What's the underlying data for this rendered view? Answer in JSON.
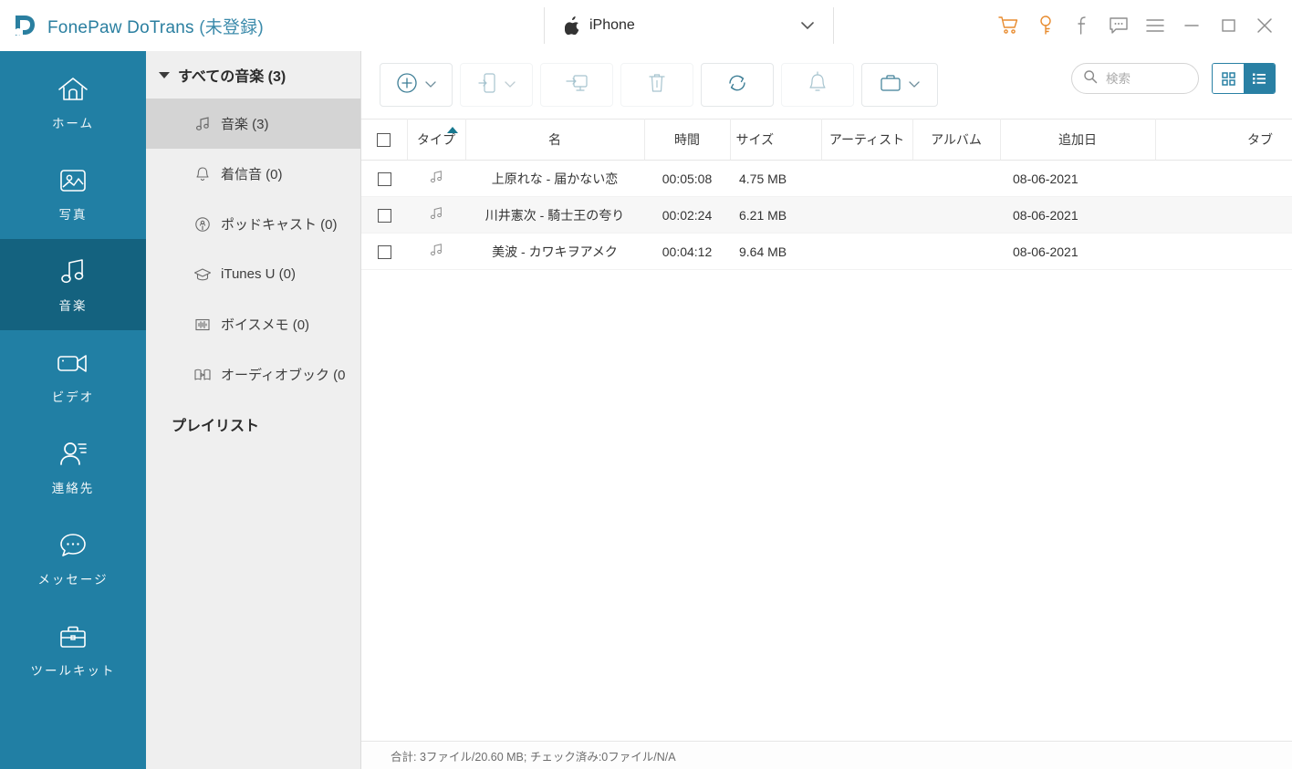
{
  "app": {
    "title": "FonePaw DoTrans",
    "title_suffix": "(未登録)",
    "accent": "#2980a4",
    "accent_dark": "#14627f",
    "orange": "#e88b2e"
  },
  "titlebar": {
    "device": {
      "name": "iPhone",
      "icon": "apple-icon",
      "chevron": "chevron-down-icon"
    },
    "icons": [
      {
        "name": "cart-icon",
        "glyph": "cart",
        "color": "#e88b2e"
      },
      {
        "name": "key-icon",
        "glyph": "key",
        "color": "#e88b2e"
      },
      {
        "name": "facebook-icon",
        "glyph": "f",
        "color": "#8d8d8d"
      },
      {
        "name": "feedback-chat-icon",
        "glyph": "chat",
        "color": "#8d8d8d"
      },
      {
        "name": "menu-icon",
        "glyph": "hamburger",
        "color": "#8d8d8d"
      },
      {
        "name": "minimize-icon",
        "glyph": "minimize",
        "color": "#8d8d8d"
      },
      {
        "name": "maximize-icon",
        "glyph": "maximize",
        "color": "#8d8d8d"
      },
      {
        "name": "close-icon",
        "glyph": "close",
        "color": "#8d8d8d"
      }
    ]
  },
  "sidebar": {
    "items": [
      {
        "label": "ホーム",
        "icon": "home-icon",
        "active": false
      },
      {
        "label": "写真",
        "icon": "photo-icon",
        "active": false
      },
      {
        "label": "音楽",
        "icon": "music-icon",
        "active": true
      },
      {
        "label": "ビデオ",
        "icon": "video-icon",
        "active": false
      },
      {
        "label": "連絡先",
        "icon": "contacts-icon",
        "active": false
      },
      {
        "label": "メッセージ",
        "icon": "message-icon",
        "active": false
      },
      {
        "label": "ツールキット",
        "icon": "toolkit-icon",
        "active": false
      }
    ]
  },
  "tree": {
    "header": "すべての音楽 (3)",
    "items": [
      {
        "label": "音楽 (3)",
        "icon": "music-note-icon",
        "selected": true
      },
      {
        "label": "着信音 (0)",
        "icon": "bell-icon",
        "selected": false
      },
      {
        "label": "ポッドキャスト (0)",
        "icon": "podcast-icon",
        "selected": false
      },
      {
        "label": "iTunes U (0)",
        "icon": "graduation-cap-icon",
        "selected": false
      },
      {
        "label": "ボイスメモ (0)",
        "icon": "waveform-icon",
        "selected": false
      },
      {
        "label": "オーディオブック (0",
        "icon": "audiobook-icon",
        "selected": false
      }
    ],
    "section": "プレイリスト"
  },
  "toolbar": {
    "buttons": [
      {
        "name": "add-button",
        "icon": "plus-circle-icon",
        "dropdown": true,
        "disabled": false
      },
      {
        "name": "export-to-device-button",
        "icon": "phone-export-icon",
        "dropdown": true,
        "disabled": true
      },
      {
        "name": "export-to-pc-button",
        "icon": "monitor-export-icon",
        "dropdown": false,
        "disabled": true
      },
      {
        "name": "delete-button",
        "icon": "trash-icon",
        "dropdown": false,
        "disabled": true
      },
      {
        "name": "refresh-button",
        "icon": "refresh-icon",
        "dropdown": false,
        "disabled": false
      },
      {
        "name": "ringtone-maker-button",
        "icon": "bell-icon",
        "dropdown": false,
        "disabled": true
      },
      {
        "name": "toolbox-button",
        "icon": "toolbox-icon",
        "dropdown": true,
        "disabled": false
      }
    ],
    "search_placeholder": "検索",
    "search_value": "",
    "view_grid": "grid-view-icon",
    "view_list": "list-view-icon",
    "active_view": "list"
  },
  "table": {
    "columns": [
      {
        "key": "chk",
        "label": "",
        "sorted": false
      },
      {
        "key": "type",
        "label": "タイプ",
        "sorted": true,
        "dir": "asc"
      },
      {
        "key": "name",
        "label": "名",
        "sorted": false
      },
      {
        "key": "time",
        "label": "時間",
        "sorted": false
      },
      {
        "key": "size",
        "label": "サイズ",
        "sorted": false
      },
      {
        "key": "artist",
        "label": "アーティスト",
        "sorted": false
      },
      {
        "key": "album",
        "label": "アルバム",
        "sorted": false
      },
      {
        "key": "added",
        "label": "追加日",
        "sorted": false
      },
      {
        "key": "tab",
        "label": "タブ",
        "sorted": false
      }
    ],
    "rows": [
      {
        "checked": false,
        "type_icon": "music-note-icon",
        "name": "上原れな - 届かない恋",
        "time": "00:05:08",
        "size": "4.75 MB",
        "artist": "",
        "album": "",
        "added": "08-06-2021",
        "tab": ""
      },
      {
        "checked": false,
        "type_icon": "music-note-icon",
        "name": "川井憲次 - 騎士王の夸り",
        "time": "00:02:24",
        "size": "6.21 MB",
        "artist": "",
        "album": "",
        "added": "08-06-2021",
        "tab": ""
      },
      {
        "checked": false,
        "type_icon": "music-note-icon",
        "name": "美波 - カワキヲアメク",
        "time": "00:04:12",
        "size": "9.64 MB",
        "artist": "",
        "album": "",
        "added": "08-06-2021",
        "tab": ""
      }
    ],
    "select_all_checked": false
  },
  "statusbar": {
    "text": "合計: 3ファイル/20.60 MB; チェック済み:0ファイル/N/A"
  }
}
